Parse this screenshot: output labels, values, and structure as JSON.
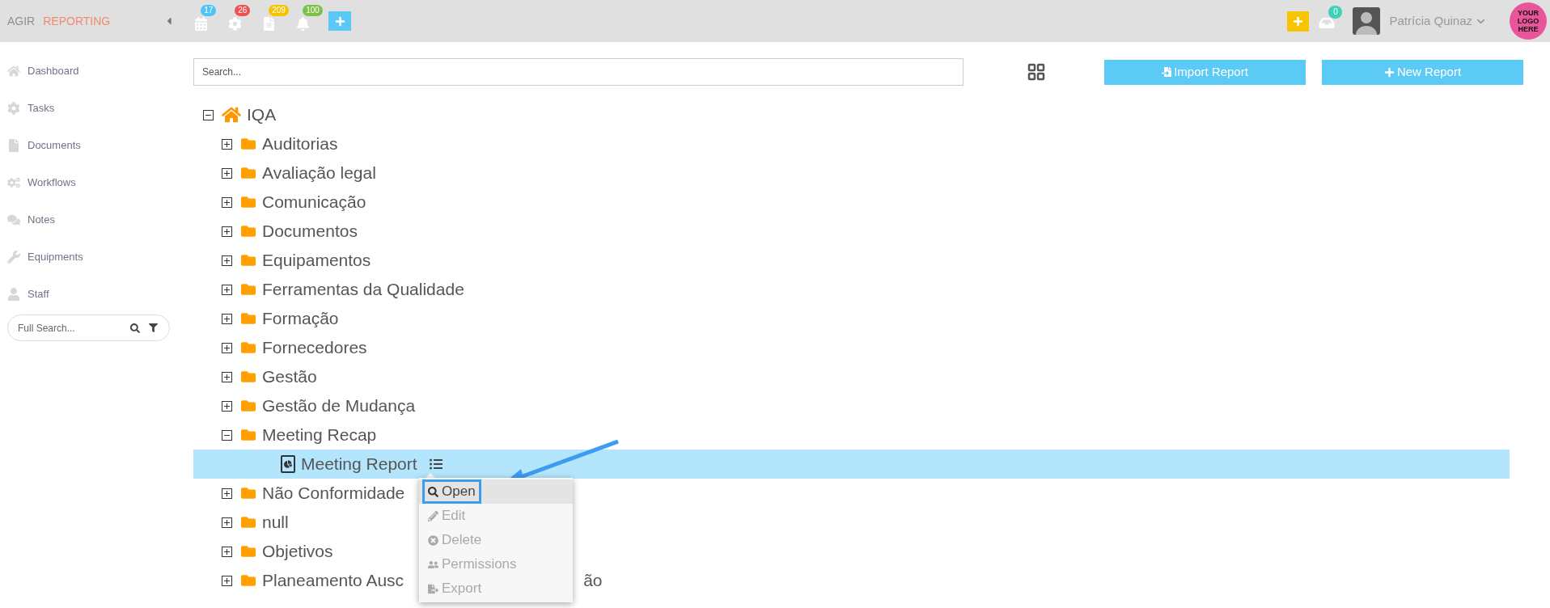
{
  "top_bar": {
    "brand": "AGIR",
    "module": "REPORTING",
    "shortcuts": [
      {
        "kind": "calendar",
        "badge": "17",
        "color": "#4ec3f5"
      },
      {
        "kind": "cog",
        "badge": "26",
        "color": "#f05050"
      },
      {
        "kind": "file",
        "badge": "209",
        "color": "#f5c400"
      },
      {
        "kind": "bell",
        "badge": "100",
        "color": "#7cc04c"
      }
    ],
    "inbox_badge": "0",
    "user": {
      "name": "Patrícia Quinaz"
    },
    "logo": [
      "YOUR",
      "LOGO",
      "HERE"
    ]
  },
  "sidebar": {
    "items": [
      {
        "kind": "home",
        "label": "Dashboard"
      },
      {
        "kind": "cog",
        "label": "Tasks"
      },
      {
        "kind": "file",
        "label": "Documents"
      },
      {
        "kind": "cogs",
        "label": "Workflows"
      },
      {
        "kind": "comments",
        "label": "Notes"
      },
      {
        "kind": "wrench",
        "label": "Equipments"
      },
      {
        "kind": "user",
        "label": "Staff"
      }
    ],
    "search": {
      "placeholder": "Full Search..."
    }
  },
  "toolbar": {
    "search": {
      "placeholder": "Search..."
    },
    "buttons": [
      {
        "kind": "import",
        "label": "Import Report"
      },
      {
        "kind": "new",
        "label": "New Report"
      }
    ]
  },
  "tree": {
    "kind": "home",
    "label": "IQA",
    "expanded": true,
    "selected": false,
    "children": [
      {
        "kind": "folder",
        "label": "Auditorias",
        "expanded": false,
        "selected": false
      },
      {
        "kind": "folder",
        "label": "Avaliação legal",
        "expanded": false,
        "selected": false
      },
      {
        "kind": "folder",
        "label": "Comunicação",
        "expanded": false,
        "selected": false
      },
      {
        "kind": "folder",
        "label": "Documentos",
        "expanded": false,
        "selected": false
      },
      {
        "kind": "folder",
        "label": "Equipamentos",
        "expanded": false,
        "selected": false
      },
      {
        "kind": "folder",
        "label": "Ferramentas da Qualidade",
        "expanded": false,
        "selected": false
      },
      {
        "kind": "folder",
        "label": "Formação",
        "expanded": false,
        "selected": false
      },
      {
        "kind": "folder",
        "label": "Fornecedores",
        "expanded": false,
        "selected": false
      },
      {
        "kind": "folder",
        "label": "Gestão",
        "expanded": false,
        "selected": false
      },
      {
        "kind": "folder",
        "label": "Gestão de Mudança",
        "expanded": false,
        "selected": false
      },
      {
        "kind": "folder",
        "label": "Meeting Recap",
        "expanded": true,
        "selected": false,
        "children": [
          {
            "kind": "report",
            "label": "Meeting Report",
            "selected": true
          }
        ]
      },
      {
        "kind": "folder",
        "label": "Não Conformidade",
        "expanded": false,
        "selected": false
      },
      {
        "kind": "folder",
        "label": "null",
        "expanded": false,
        "selected": false
      },
      {
        "kind": "folder",
        "label": "Objetivos",
        "expanded": false,
        "selected": false
      },
      {
        "kind": "folder",
        "label": "Planeamento Ausc",
        "label_tail": "ão",
        "expanded": false,
        "selected": false
      }
    ]
  },
  "context_menu": {
    "items": [
      {
        "kind": "open",
        "label": "Open",
        "selected": true,
        "disabled": false
      },
      {
        "kind": "edit",
        "label": "Edit",
        "selected": false,
        "disabled": true
      },
      {
        "kind": "delete",
        "label": "Delete",
        "selected": false,
        "disabled": true
      },
      {
        "kind": "permissions",
        "label": "Permissions",
        "selected": false,
        "disabled": true
      },
      {
        "kind": "export",
        "label": "Export",
        "selected": false,
        "disabled": true
      }
    ]
  }
}
